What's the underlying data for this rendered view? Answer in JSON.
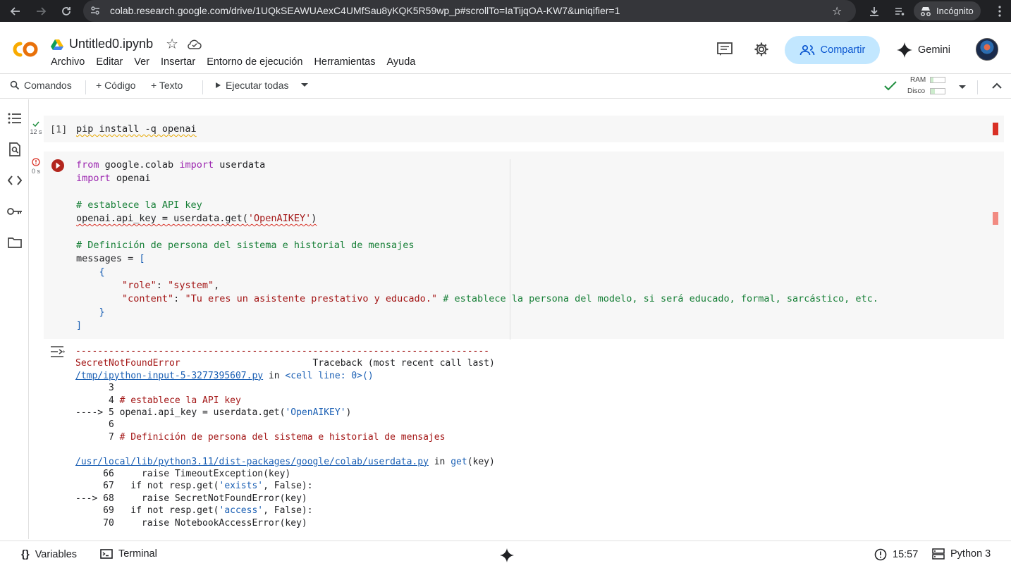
{
  "browser": {
    "url": "colab.research.google.com/drive/1UQkSEAWUAexC4UMfSau8yKQK5R59wp_p#scrollTo=IaTijqOA-KW7&uniqifier=1",
    "incognito_label": "Incógnito"
  },
  "header": {
    "logo_text": "CO",
    "title": "Untitled0.ipynb",
    "menu": [
      "Archivo",
      "Editar",
      "Ver",
      "Insertar",
      "Entorno de ejecución",
      "Herramientas",
      "Ayuda"
    ],
    "share_label": "Compartir",
    "gemini_label": "Gemini"
  },
  "toolbar": {
    "commands_label": "Comandos",
    "code_label": "+ Código",
    "text_label": "+ Texto",
    "run_all_label": "Ejecutar todas",
    "ram_label": "RAM",
    "disk_label": "Disco"
  },
  "cells": {
    "cell1": {
      "exec_count": "[1]",
      "status_time": "12 s",
      "code": "pip install -q openai"
    },
    "cell2": {
      "status_time": "0 s",
      "lines": {
        "l1_kw": "from",
        "l1_mod": " google.colab ",
        "l1_kw2": "import",
        "l1_rest": " userdata",
        "l2_kw": "import",
        "l2_rest": " openai",
        "l4": "# establece la API key",
        "l5a": "openai.api_key = userdata.get(",
        "l5s": "'OpenAIKEY'",
        "l5b": ")",
        "l7": "# Definición de persona del sistema e historial de mensajes",
        "l8a": "messages = ",
        "l8b": "[",
        "l9": "    {",
        "l10k": "        \"role\"",
        "l10c": ": ",
        "l10v": "\"system\"",
        "l10e": ",",
        "l11k": "        \"content\"",
        "l11c": ": ",
        "l11v": "\"Tu eres un asistente prestativo y educado.\"",
        "l11m": " # establece la persona del modelo, si será educado, formal, sarcástico, etc.",
        "l12": "    }",
        "l13": "]"
      }
    }
  },
  "output": {
    "dashes": "---------------------------------------------------------------------------",
    "error_name": "SecretNotFoundError",
    "traceback_label": "                        Traceback (most recent call last)",
    "file1": "/tmp/ipython-input-5-3277395607.py",
    "in1": " in ",
    "cell_ref": "<cell line: 0>",
    "cell_ref_end": "()",
    "t1": "      3",
    "t2a": "      4 ",
    "t2b": "# establece la API key",
    "t3a": "----> 5 ",
    "t3b": "openai.api_key = userdata.get(",
    "t3s": "'OpenAIKEY'",
    "t3c": ")",
    "t4": "      6",
    "t5a": "      7 ",
    "t5b": "# Definición de persona del sistema e historial de mensajes",
    "file2": "/usr/local/lib/python3.11/dist-packages/google/colab/userdata.py",
    "in2": " in ",
    "func": "get",
    "func_args": "(key)",
    "u1": "     66     raise TimeoutException(key)",
    "u2a": "     67   if not resp.get(",
    "u2s": "'exists'",
    "u2b": ", False):",
    "u3": "---> 68     raise SecretNotFoundError(key)",
    "u4a": "     69   if not resp.get(",
    "u4s": "'access'",
    "u4b": ", False):",
    "u5": "     70     raise NotebookAccessError(key)"
  },
  "statusbar": {
    "variables_label": "Variables",
    "terminal_label": "Terminal",
    "time": "15:57",
    "kernel_label": "Python 3"
  },
  "colors": {
    "logo_orange": "#f9ab00",
    "share_bg": "#c2e7ff",
    "share_fg": "#0b57d0",
    "error_red": "#d93025",
    "check_green": "#1e8e3e"
  }
}
